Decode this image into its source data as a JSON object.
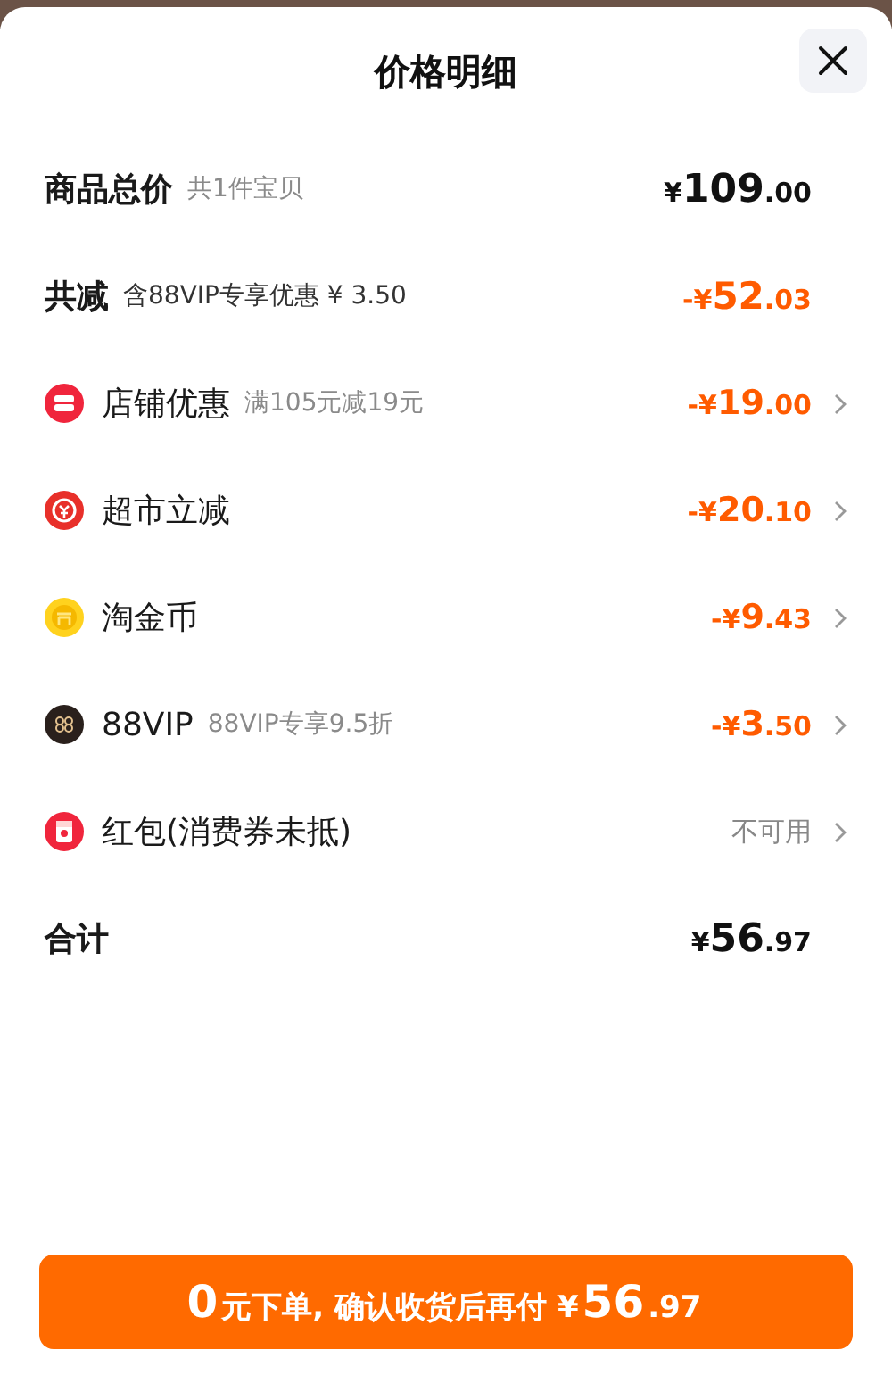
{
  "title": "价格明细",
  "rows": [
    {
      "kind": "total",
      "label": "商品总价",
      "note": "共1件宝贝",
      "amount": {
        "currency": "¥",
        "major": "109",
        "minor": ".00"
      },
      "arrow": false
    },
    {
      "kind": "summary",
      "label": "共减",
      "note": "含88VIP专享优惠 ¥ 3.50",
      "amount": {
        "sign": "-",
        "currency": "¥",
        "major": "52",
        "minor": ".03"
      },
      "arrow": false
    },
    {
      "kind": "item",
      "label": "店铺优惠",
      "note": "满105元减19元",
      "amount": {
        "sign": "-",
        "currency": "¥",
        "major": "19",
        "minor": ".00"
      },
      "arrow": true
    },
    {
      "kind": "item",
      "label": "超市立减",
      "amount": {
        "sign": "-",
        "currency": "¥",
        "major": "20",
        "minor": ".10"
      },
      "arrow": true
    },
    {
      "kind": "item",
      "label": "淘金币",
      "amount": {
        "sign": "-",
        "currency": "¥",
        "major": "9",
        "minor": ".43"
      },
      "arrow": true
    },
    {
      "kind": "item",
      "label": "88VIP",
      "note": "88VIP专享9.5折",
      "amount": {
        "sign": "-",
        "currency": "¥",
        "major": "3",
        "minor": ".50"
      },
      "arrow": true
    },
    {
      "kind": "item",
      "label": "红包(消费券未抵)",
      "status": "不可用",
      "arrow": true
    },
    {
      "kind": "total",
      "label": "合计",
      "amount": {
        "currency": "¥",
        "major": "56",
        "minor": ".97"
      },
      "arrow": false
    }
  ],
  "button": {
    "lead": "0",
    "text": "元下单, 确认收货后再付 ¥",
    "major": "56",
    "minor": ".97"
  }
}
